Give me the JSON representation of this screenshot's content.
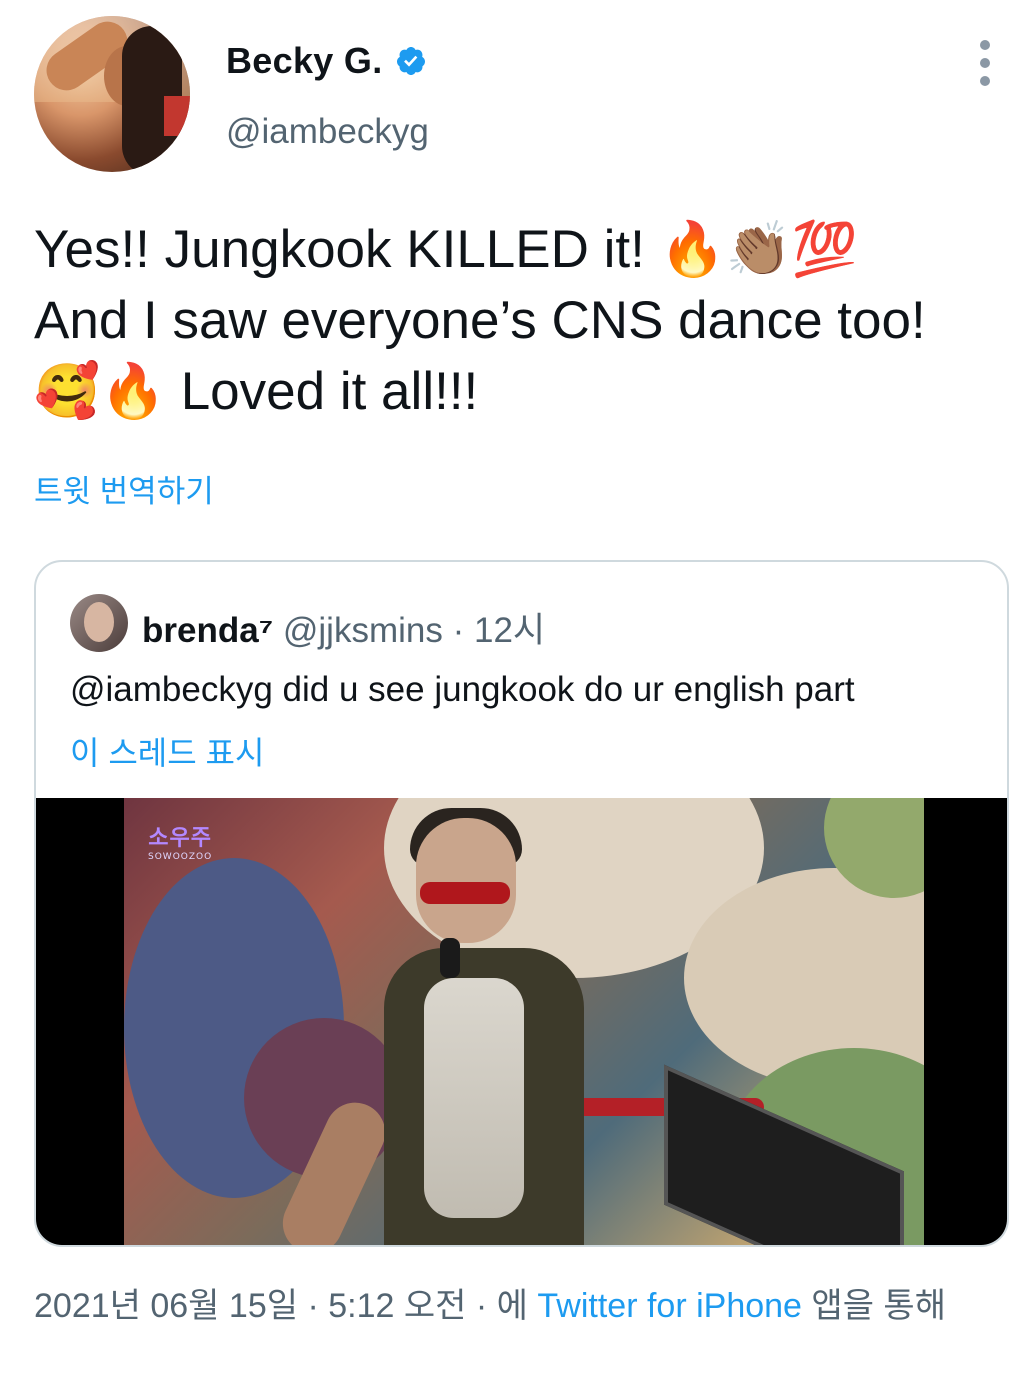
{
  "author": {
    "display_name": "Becky G.",
    "handle": "@iambeckyg",
    "verified": true,
    "avatar_icon": "profile-photo"
  },
  "tweet": {
    "lines": [
      "Yes!! Jungkook KILLED it! 🔥👏🏽💯",
      "And I saw everyone’s CNS dance too!",
      "🥰🔥 Loved it all!!!"
    ]
  },
  "translate_label": "트윗 번역하기",
  "quoted_tweet": {
    "name": "brenda⁷",
    "handle": "@jjksmins",
    "separator": "·",
    "time": "12시",
    "text": "@iambeckyg did u see jungkook do ur english part",
    "show_thread_label": "이 스레드 표시",
    "media": {
      "logo_main": "소우주",
      "logo_sub": "SOWOOZOO"
    }
  },
  "footer": {
    "date": "2021년 06월 15일",
    "separator": "·",
    "time": "5:12 오전",
    "via_prefix": "에",
    "app_name": "Twitter for iPhone",
    "via_suffix": "앱을 통해"
  },
  "colors": {
    "link": "#1d9bf0",
    "secondary_text": "#536471",
    "verified": "#1d9bf0",
    "border": "#cfd9de"
  }
}
